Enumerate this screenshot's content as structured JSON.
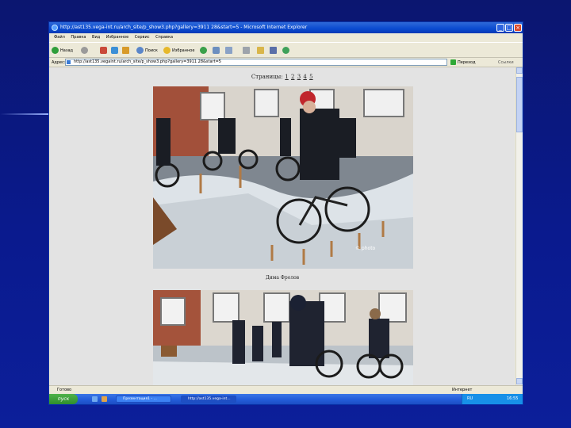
{
  "window": {
    "title": "http://ast135.vega-int.ru/arch_site/p_show3.php?gallery=3911 28&start=5 - Microsoft Internet Explorer",
    "minimize": "_",
    "maximize": "□",
    "close": "×"
  },
  "menu": [
    "Файл",
    "Правка",
    "Вид",
    "Избранное",
    "Сервис",
    "Справка"
  ],
  "toolbar": {
    "back": "Назад",
    "search": "Поиск",
    "favorites": "Избранное"
  },
  "address": {
    "label": "Адрес:",
    "url": "http://ast135.vegaint.ru/arch_site/p_show3.php?gallery=3911 28&start=5",
    "go": "Переход",
    "links": "Ссылки"
  },
  "page": {
    "pages_label": "Страницы:",
    "pages": [
      "1",
      "2",
      "3",
      "4",
      "5"
    ],
    "caption": "Дима Фролов"
  },
  "status": {
    "left": "Готово",
    "right": "Интернет"
  },
  "taskbar": {
    "start": "пуск",
    "tasks": [
      "Презентация1 - ...",
      "http://ast135.vega-int..."
    ],
    "lang": "RU",
    "clock": "16:55"
  },
  "colors": {
    "background": "#0a1a8e",
    "titlebar": "#0a4ad0",
    "taskbar": "#245edb",
    "start": "#2f8f2c"
  }
}
